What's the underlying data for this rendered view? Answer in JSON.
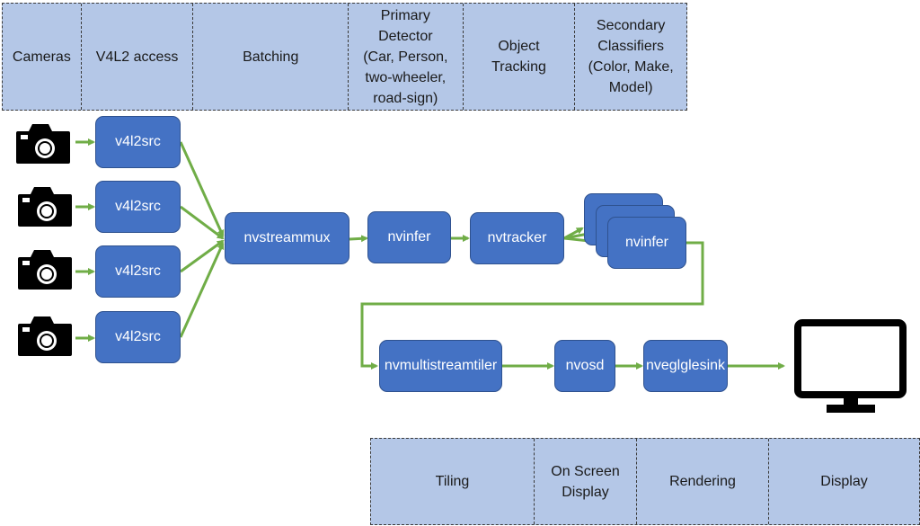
{
  "top_stages": [
    {
      "label": "Cameras"
    },
    {
      "label": "V4L2 access"
    },
    {
      "label": "Batching"
    },
    {
      "label": "Primary\nDetector\n(Car, Person,\ntwo-wheeler,\nroad-sign)"
    },
    {
      "label": "Object\nTracking"
    },
    {
      "label": "Secondary\nClassifiers\n(Color, Make,\nModel)"
    }
  ],
  "bottom_stages": [
    {
      "label": "Tiling"
    },
    {
      "label": "On Screen\nDisplay"
    },
    {
      "label": "Rendering"
    },
    {
      "label": "Display"
    }
  ],
  "sources": [
    {
      "camera_icon": "camera-icon",
      "label": "v4l2src"
    },
    {
      "camera_icon": "camera-icon",
      "label": "v4l2src"
    },
    {
      "camera_icon": "camera-icon",
      "label": "v4l2src"
    },
    {
      "camera_icon": "camera-icon",
      "label": "v4l2src"
    }
  ],
  "pipeline": {
    "muxer": "nvstreammux",
    "primary_infer": "nvinfer",
    "tracker": "nvtracker",
    "secondary_infer": "nvinfer",
    "tiler": "nvmultistreamtiler",
    "osd": "nvosd",
    "sink": "nveglglesink",
    "display_icon": "monitor-icon"
  },
  "colors": {
    "node_fill": "#4472c4",
    "stage_fill": "#b4c7e7",
    "edge": "#70ad47"
  }
}
